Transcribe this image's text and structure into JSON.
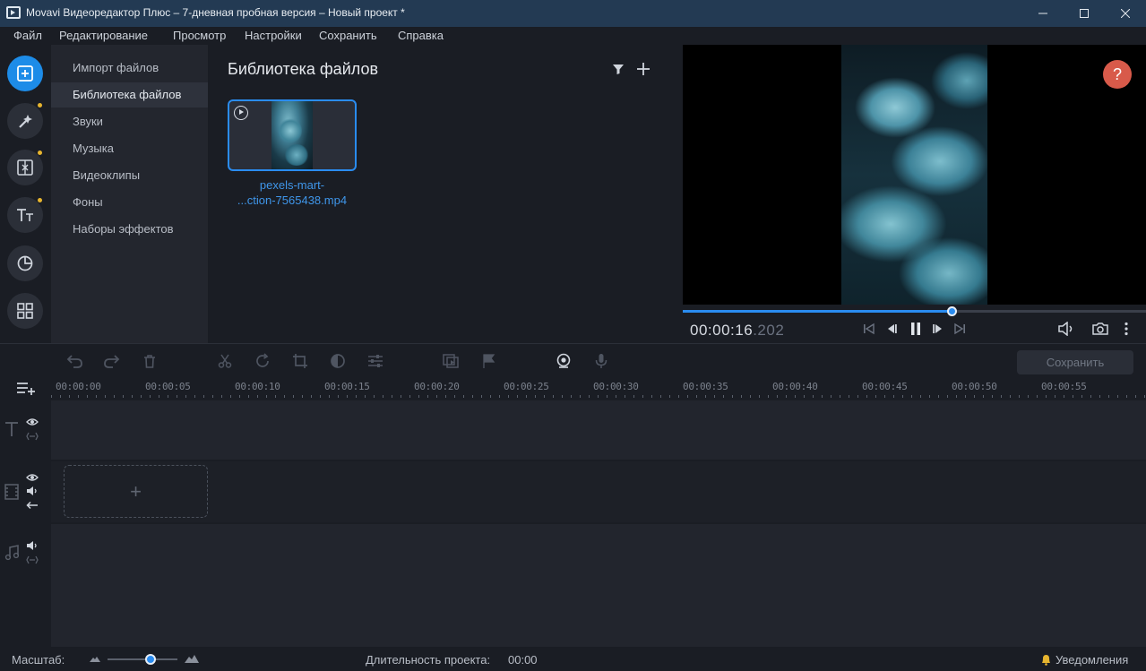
{
  "window": {
    "title": "Movavi Видеоредактор Плюс – 7-дневная пробная версия – Новый проект *"
  },
  "menu": {
    "items": [
      {
        "label": "Файл"
      },
      {
        "label": "Редактирование"
      },
      {
        "label": "Просмотр"
      },
      {
        "label": "Настройки"
      },
      {
        "label": "Сохранить"
      },
      {
        "label": "Справка"
      }
    ]
  },
  "sidebar": {
    "rail": [
      {
        "icon": "import-icon",
        "active": true
      },
      {
        "icon": "magic-wand-icon",
        "badge": true
      },
      {
        "icon": "transitions-icon",
        "badge": true
      },
      {
        "icon": "titles-icon",
        "badge": true
      },
      {
        "icon": "stickers-icon"
      },
      {
        "icon": "more-tools-icon"
      }
    ],
    "categories": [
      {
        "label": "Импорт файлов"
      },
      {
        "label": "Библиотека файлов",
        "selected": true
      },
      {
        "label": "Звуки"
      },
      {
        "label": "Музыка"
      },
      {
        "label": "Видеоклипы"
      },
      {
        "label": "Фоны"
      },
      {
        "label": "Наборы эффектов"
      }
    ]
  },
  "library": {
    "title": "Библиотека файлов",
    "files": [
      {
        "name_line1": "pexels-mart-",
        "name_line2": "...ction-7565438.mp4"
      }
    ]
  },
  "preview": {
    "help": "?",
    "time_main": "00:00:16",
    "time_ms": ".202",
    "progress": 0.58
  },
  "toolbar": {
    "save_label": "Сохранить"
  },
  "timeline": {
    "ticks": [
      "00:00:00",
      "00:00:05",
      "00:00:10",
      "00:00:15",
      "00:00:20",
      "00:00:25",
      "00:00:30",
      "00:00:35",
      "00:00:40",
      "00:00:45",
      "00:00:50",
      "00:00:55"
    ],
    "add_symbol": "+"
  },
  "status": {
    "zoom_label": "Масштаб:",
    "zoom_level": 0.62,
    "duration_label": "Длительность проекта:",
    "duration_value": "00:00",
    "notifications": "Уведомления"
  },
  "colors": {
    "accent": "#2a8cf0",
    "titlebar": "#233a53",
    "help": "#d85a4a",
    "badge": "#e7b52f"
  }
}
